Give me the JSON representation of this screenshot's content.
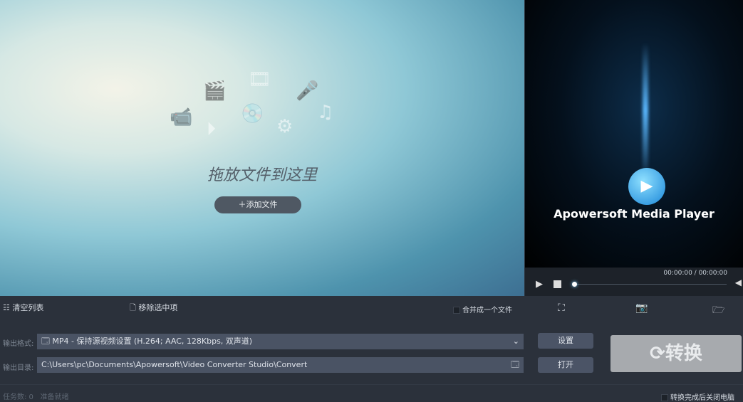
{
  "drop_area": {
    "title": "拖放文件到这里",
    "add_button": "添加文件"
  },
  "player": {
    "title": "Apowersoft Media Player",
    "time": "00:00:00 / 00:00:00",
    "progress": 0
  },
  "toolbar": {
    "clear_list": "清空列表",
    "remove_selected": "移除选中项",
    "merge_label": "合并成一个文件",
    "merge_checked": false
  },
  "output": {
    "format_label": "输出格式:",
    "format_value": "MP4 - 保持源视频设置 (H.264; AAC, 128Kbps, 双声道)",
    "dir_label": "输出目录:",
    "dir_value": "C:\\Users\\pc\\Documents\\Apowersoft\\Video Converter Studio\\Convert",
    "settings_button": "设置",
    "open_button": "打开"
  },
  "convert_button": "转换",
  "shutdown_label": "转换完成后关闭电脑",
  "status": {
    "tasks": "任务数: 0",
    "state": "准备就绪"
  }
}
